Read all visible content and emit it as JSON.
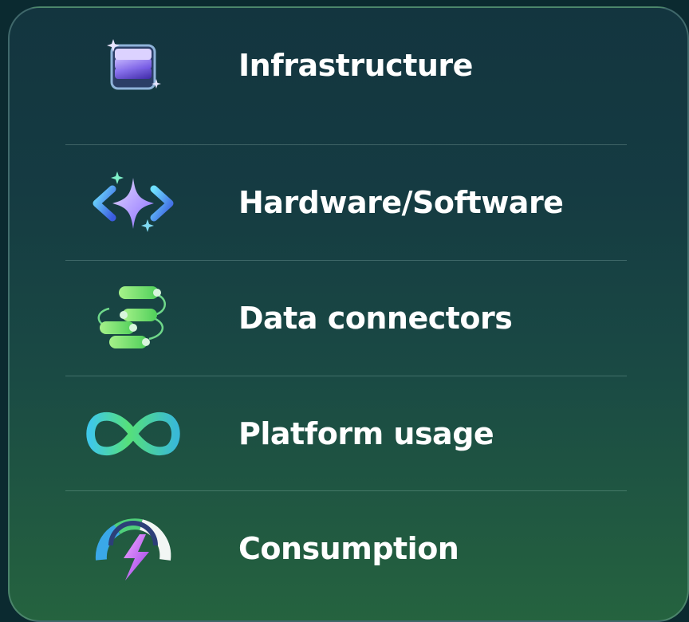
{
  "items": [
    {
      "label": "Infrastructure",
      "icon": "stacked-layers-icon"
    },
    {
      "label": "Hardware/Software",
      "icon": "code-sparkle-icon"
    },
    {
      "label": "Data connectors",
      "icon": "connected-pills-icon"
    },
    {
      "label": "Platform usage",
      "icon": "infinity-icon"
    },
    {
      "label": "Consumption",
      "icon": "gauge-lightning-icon"
    }
  ],
  "colors": {
    "background_top": "#13353f",
    "background_bottom": "#25633f",
    "text": "#ffffff",
    "divider": "#aad2c8"
  }
}
